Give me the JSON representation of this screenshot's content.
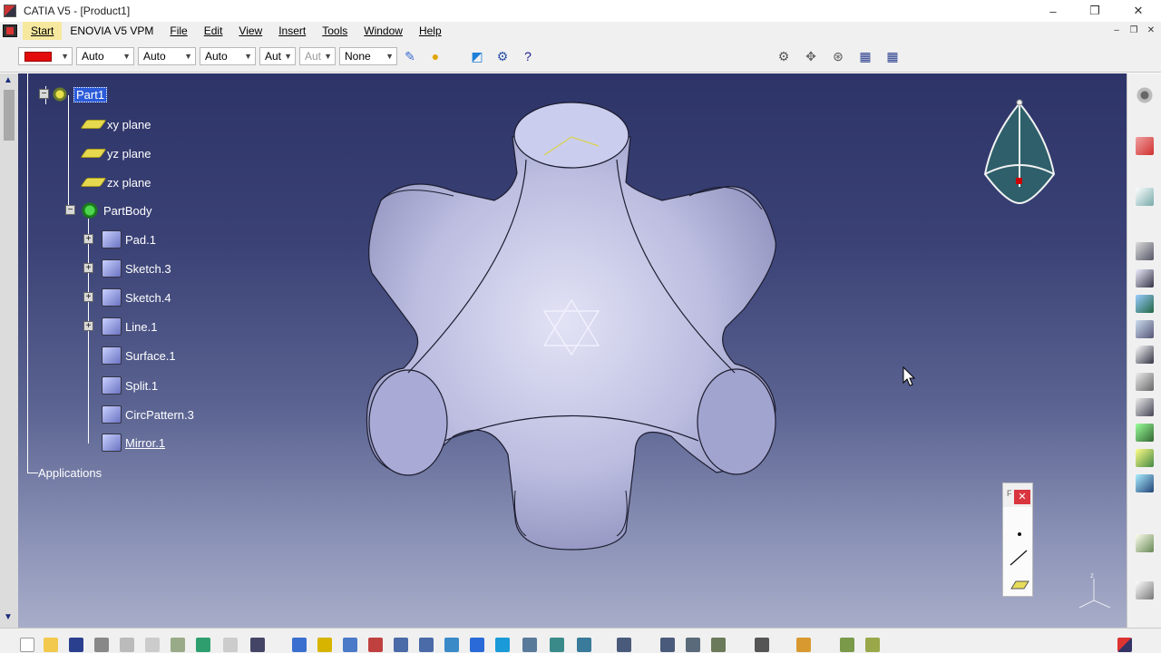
{
  "window": {
    "title": "CATIA V5 - [Product1]",
    "controls": {
      "minimize": "–",
      "maximize": "❐",
      "close": "✕"
    }
  },
  "menubar": {
    "items": [
      {
        "label": "Start"
      },
      {
        "label": "ENOVIA V5 VPM"
      },
      {
        "label": "File"
      },
      {
        "label": "Edit"
      },
      {
        "label": "View"
      },
      {
        "label": "Insert"
      },
      {
        "label": "Tools"
      },
      {
        "label": "Window"
      },
      {
        "label": "Help"
      }
    ],
    "doc_controls": {
      "minimize": "–",
      "restore": "❐",
      "close": "✕"
    }
  },
  "toolbar": {
    "color": "#e30b0b",
    "combos": [
      {
        "value": "Auto"
      },
      {
        "value": "Auto"
      },
      {
        "value": "Auto"
      },
      {
        "value": "Aut"
      },
      {
        "value": "Aut",
        "disabled": true
      },
      {
        "value": "None"
      }
    ]
  },
  "tree": {
    "root": {
      "label": "Part1"
    },
    "planes": [
      {
        "label": "xy plane"
      },
      {
        "label": "yz plane"
      },
      {
        "label": "zx plane"
      }
    ],
    "body": {
      "label": "PartBody"
    },
    "features": [
      {
        "label": "Pad.1",
        "icon": "pad-icon"
      },
      {
        "label": "Sketch.3",
        "icon": "sketch-icon"
      },
      {
        "label": "Sketch.4",
        "icon": "sketch-icon"
      },
      {
        "label": "Line.1",
        "icon": "line-icon"
      },
      {
        "label": "Surface.1",
        "icon": "surface-icon"
      },
      {
        "label": "Split.1",
        "icon": "split-icon"
      },
      {
        "label": "CircPattern.3",
        "icon": "circ-pattern-icon"
      },
      {
        "label": "Mirror.1",
        "icon": "mirror-icon"
      }
    ],
    "applications": {
      "label": "Applications"
    }
  },
  "colors": {
    "viewport_top": "#2d3468",
    "viewport_bottom": "#a7adc8",
    "part_fill": "#c4c6e8",
    "selection": "#2b5bd8"
  }
}
